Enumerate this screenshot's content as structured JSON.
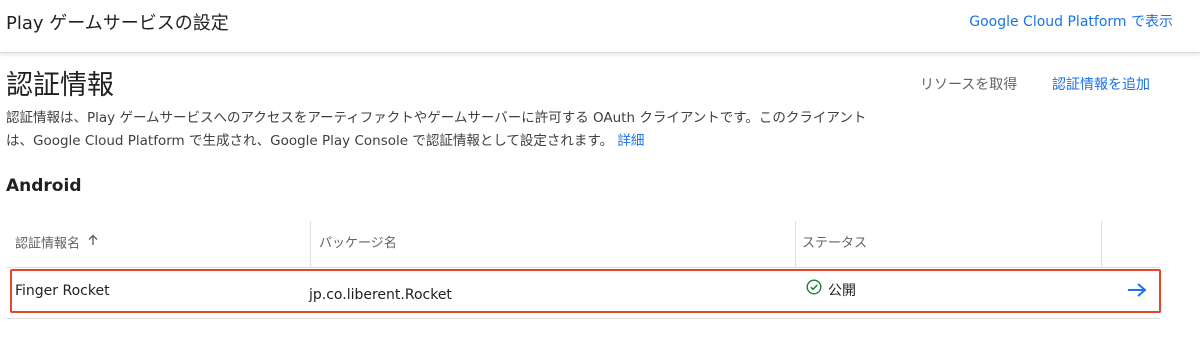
{
  "header": {
    "title": "Play ゲームサービスの設定",
    "cloud_link": "Google Cloud Platform で表示"
  },
  "section": {
    "title": "認証情報",
    "get_resources": "リソースを取得",
    "add_credentials": "認証情報を追加",
    "description_line1": "認証情報は、Play ゲームサービスへのアクセスをアーティファクトやゲームサーバーに許可する OAuth クライアントです。このクライアント",
    "description_line2": "は、Google Cloud Platform で生成され、Google Play Console で認証情報として設定されます。",
    "learn_more": "詳細"
  },
  "android": {
    "heading": "Android",
    "columns": {
      "name": "認証情報名",
      "package": "パッケージ名",
      "status": "ステータス"
    },
    "rows": [
      {
        "name": "Finger Rocket",
        "package": "jp.co.liberent.Rocket",
        "status": "公開"
      }
    ]
  },
  "colors": {
    "link_blue": "#1a73e8",
    "status_green": "#188038",
    "highlight_red": "#e8452c"
  },
  "icons": {
    "sort": "arrow-up-icon",
    "status": "check-circle-icon",
    "row_action": "arrow-right-icon"
  }
}
